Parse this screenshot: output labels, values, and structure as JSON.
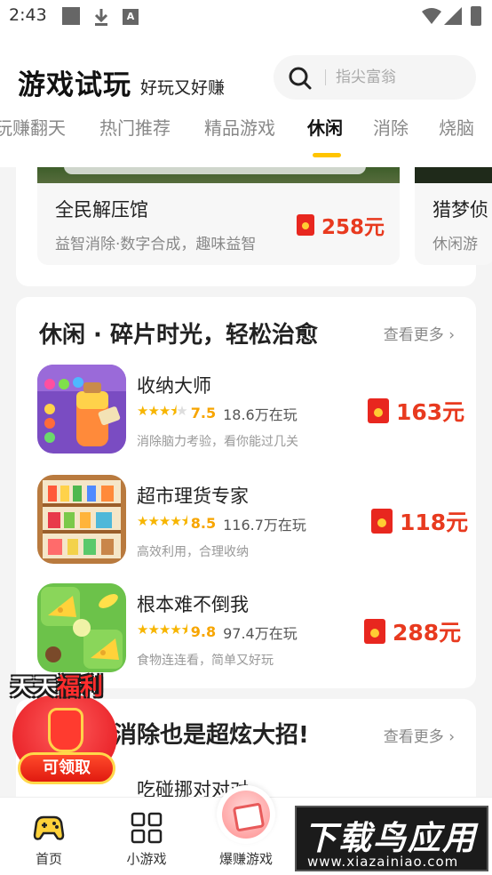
{
  "status_bar": {
    "time": "2:43",
    "a_badge": "A"
  },
  "header": {
    "title": "游戏试玩",
    "subtitle": "好玩又好赚",
    "search_placeholder": "指尖富翁"
  },
  "tabs": [
    {
      "label": "玩赚翻天"
    },
    {
      "label": "热门推荐"
    },
    {
      "label": "精品游戏"
    },
    {
      "label": "休闲",
      "active": true
    },
    {
      "label": "消除"
    },
    {
      "label": "烧脑"
    }
  ],
  "banners": [
    {
      "title": "全民解压馆",
      "desc": "益智消除·数字合成，趣味益智",
      "reward": "258元"
    },
    {
      "title": "猎梦侦",
      "desc": "休闲游"
    }
  ],
  "section1": {
    "title": "休闲 · 碎片时光，轻松治愈",
    "see_more": "查看更多 ›",
    "games": [
      {
        "name": "收纳大师",
        "rating": "7.5",
        "stars": 3.5,
        "players": "18.6万在玩",
        "desc": "消除脑力考验，看你能过几关",
        "reward": "163元",
        "icon": "potion-sort-icon"
      },
      {
        "name": "超市理货专家",
        "rating": "8.5",
        "stars": 4.5,
        "players": "116.7万在玩",
        "desc": "高效利用，合理收纳",
        "reward": "118元",
        "icon": "shelf-goods-icon"
      },
      {
        "name": "根本难不倒我",
        "rating": "9.8",
        "stars": 5,
        "players": "97.4万在玩",
        "desc": "食物连连看，简单又好玩",
        "reward": "288元",
        "icon": "cheese-match-icon"
      }
    ]
  },
  "section2": {
    "title": "消除也是超炫大招!",
    "see_more": "查看更多 ›",
    "first_game": "吃碰挪对对对"
  },
  "promo": {
    "title_white": "天天",
    "title_red": "福利",
    "button": "可领取"
  },
  "bottom_nav": [
    {
      "label": "首页",
      "icon": "gamepad-icon",
      "active": true
    },
    {
      "label": "小游戏",
      "icon": "grid-icon"
    },
    {
      "label": "爆赚游戏",
      "icon": "money-icon"
    }
  ],
  "watermark": {
    "main": "下载鸟应用",
    "sub": "www.xiazainiao.com"
  },
  "colors": {
    "accent": "#ffc400",
    "reward": "#e83a1f",
    "star": "#f7b500"
  }
}
